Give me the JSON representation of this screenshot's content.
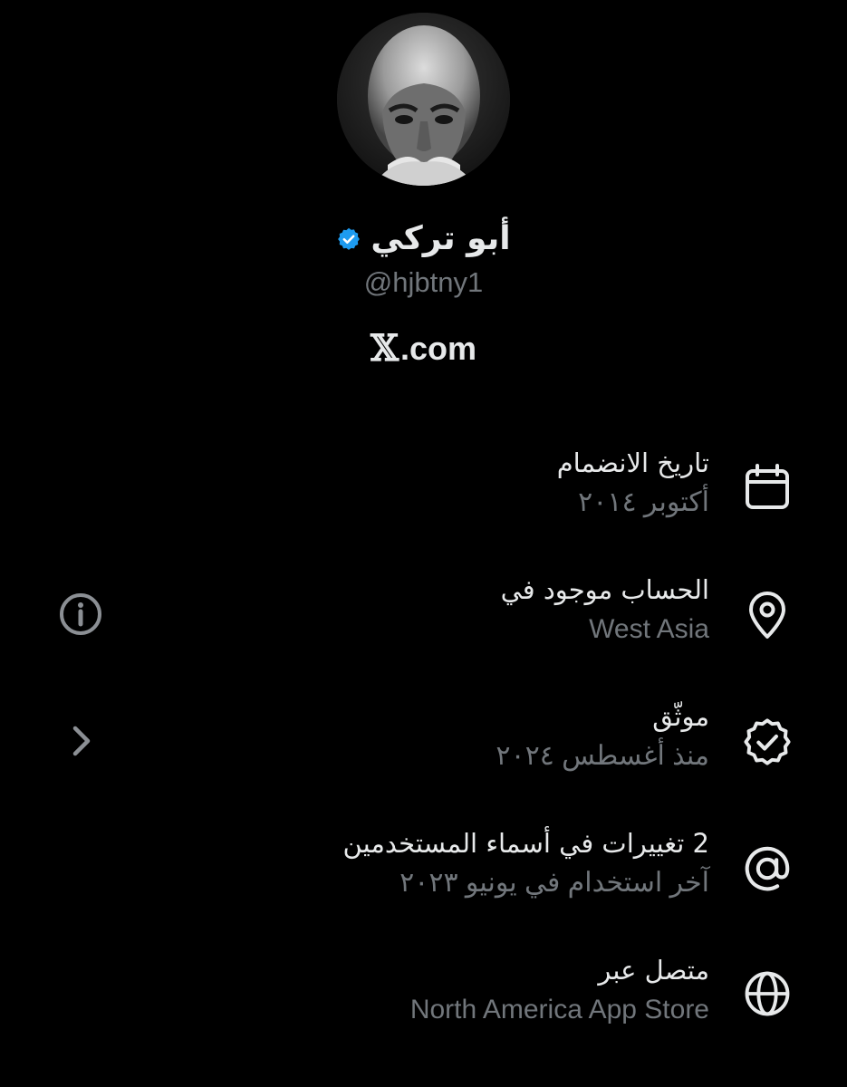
{
  "profile": {
    "display_name": "أبو تركي",
    "handle": "@hjbtny1",
    "site_logo": "𝕏",
    "site_domain": ".com",
    "avatar_icon": "profile-photo",
    "verified_icon": "verified-badge-icon",
    "verified_color": "#1d9bf0"
  },
  "about": {
    "rows": [
      {
        "icon": "calendar-icon",
        "title": "تاريخ الانضمام",
        "subtitle": "أكتوبر ٢٠١٤"
      },
      {
        "icon": "location-pin-icon",
        "title": "الحساب موجود في",
        "subtitle": "West Asia",
        "side_icon": "info-icon"
      },
      {
        "icon": "verified-check-icon",
        "title": "موثّق",
        "subtitle": "منذ أغسطس ٢٠٢٤",
        "side_icon": "chevron-right-icon"
      },
      {
        "icon": "at-sign-icon",
        "title": "2 تغييرات في أسماء المستخدمين",
        "subtitle": "آخر استخدام في يونيو ٢٠٢٣"
      },
      {
        "icon": "globe-icon",
        "title": "متصل عبر",
        "subtitle": "North America App Store"
      }
    ]
  },
  "colors": {
    "background": "#000000",
    "primary_text": "#e7e9ea",
    "secondary_text": "#71767b"
  }
}
